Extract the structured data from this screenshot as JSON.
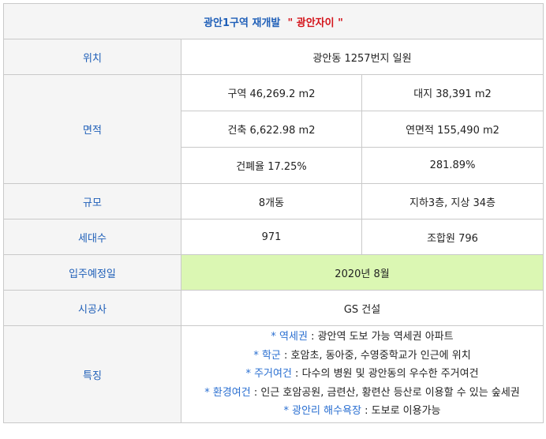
{
  "title": {
    "main": "광안1구역 재개발",
    "quote": "\" 광안자이 \""
  },
  "rows": {
    "location": {
      "label": "위치",
      "value": "광안동 1257번지 일원"
    },
    "area": {
      "label": "면적",
      "cells": [
        [
          "구역 46,269.2 m2",
          "대지 38,391 m2"
        ],
        [
          "건축 6,622.98 m2",
          "연면적 155,490 m2"
        ],
        [
          "건폐율 17.25%",
          "281.89%"
        ]
      ]
    },
    "scale": {
      "label": "규모",
      "left": "8개동",
      "right": "지하3층, 지상 34층"
    },
    "households": {
      "label": "세대수",
      "left": "971",
      "right": "조합원 796"
    },
    "move_in": {
      "label": "입주예정일",
      "value": "2020년 8월"
    },
    "builder": {
      "label": "시공사",
      "value": "GS 건설"
    },
    "features": {
      "label": "특징",
      "items": [
        {
          "key": "* 역세권",
          "text": " : 광안역 도보 가능 역세권 아파트"
        },
        {
          "key": "* 학군",
          "text": " : 호암초, 동아중, 수영중학교가 인근에 위치"
        },
        {
          "key": "* 주거여건",
          "text": " : 다수의 병원 및 광안동의 우수한 주거여건"
        },
        {
          "key": "* 환경여건",
          "text": " : 인근 호암공원, 금련산, 황련산 등산로 이용할 수 있는 숲세권"
        },
        {
          "key": "* 광안리 해수욕장",
          "text": " : 도보로 이용가능"
        }
      ]
    }
  },
  "colors": {
    "label_blue": "#1f5fb8",
    "title_red": "#d4141b",
    "highlight_green": "#dbf7b3",
    "label_bg": "#f5f5f5"
  }
}
